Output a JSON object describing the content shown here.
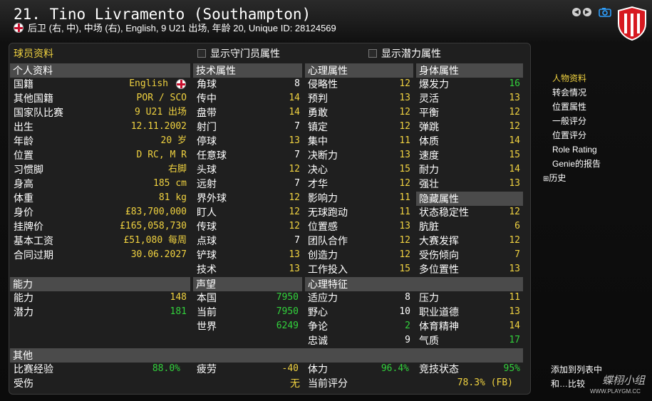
{
  "header": {
    "title": "21. Tino Livramento (Southampton)",
    "subtitle": "后卫 (右, 中), 中场 (右), English, 9 U21 出场, 年龄 20, Unique ID: 28124569",
    "section_title": "球员资料",
    "show_gk_attrs": "显示守门员属性",
    "show_potential_attrs": "显示潜力属性"
  },
  "personal": {
    "heading": "个人资料",
    "rows": [
      {
        "label": "国籍",
        "value": "English"
      },
      {
        "label": "其他国籍",
        "value": "POR / SCO"
      },
      {
        "label": "国家队比赛",
        "value": "9 U21 出场"
      },
      {
        "label": "出生",
        "value": "12.11.2002"
      },
      {
        "label": "年龄",
        "value": "20 岁"
      },
      {
        "label": "位置",
        "value": "D RC, M R"
      },
      {
        "label": "习惯脚",
        "value": "右脚"
      },
      {
        "label": "身高",
        "value": "185 cm"
      },
      {
        "label": "体重",
        "value": "81 kg"
      },
      {
        "label": "身价",
        "value": "£83,700,000"
      },
      {
        "label": "挂牌价",
        "value": "£165,058,730"
      },
      {
        "label": "基本工资",
        "value": "£51,080 每周"
      },
      {
        "label": "合同过期",
        "value": "30.06.2027"
      }
    ]
  },
  "technical": {
    "heading": "技术属性",
    "rows": [
      {
        "label": "角球",
        "value": "8",
        "color": "#ffffff"
      },
      {
        "label": "传中",
        "value": "14",
        "color": "#f0d240"
      },
      {
        "label": "盘带",
        "value": "14",
        "color": "#f0d240"
      },
      {
        "label": "射门",
        "value": "7",
        "color": "#ffffff"
      },
      {
        "label": "停球",
        "value": "13",
        "color": "#f0d240"
      },
      {
        "label": "任意球",
        "value": "7",
        "color": "#ffffff"
      },
      {
        "label": "头球",
        "value": "12",
        "color": "#f0d240"
      },
      {
        "label": "远射",
        "value": "7",
        "color": "#ffffff"
      },
      {
        "label": "界外球",
        "value": "12",
        "color": "#f0d240"
      },
      {
        "label": "盯人",
        "value": "12",
        "color": "#f0d240"
      },
      {
        "label": "传球",
        "value": "12",
        "color": "#f0d240"
      },
      {
        "label": "点球",
        "value": "7",
        "color": "#ffffff"
      },
      {
        "label": "铲球",
        "value": "13",
        "color": "#f0d240"
      },
      {
        "label": "技术",
        "value": "13",
        "color": "#f0d240"
      }
    ]
  },
  "mental": {
    "heading": "心理属性",
    "rows": [
      {
        "label": "侵略性",
        "value": "12",
        "color": "#f0d240"
      },
      {
        "label": "预判",
        "value": "13",
        "color": "#f0d240"
      },
      {
        "label": "勇敢",
        "value": "12",
        "color": "#f0d240"
      },
      {
        "label": "镇定",
        "value": "12",
        "color": "#f0d240"
      },
      {
        "label": "集中",
        "value": "11",
        "color": "#f0d240"
      },
      {
        "label": "决断力",
        "value": "13",
        "color": "#f0d240"
      },
      {
        "label": "决心",
        "value": "15",
        "color": "#f0d240"
      },
      {
        "label": "才华",
        "value": "12",
        "color": "#f0d240"
      },
      {
        "label": "影响力",
        "value": "11",
        "color": "#f0d240"
      },
      {
        "label": "无球跑动",
        "value": "11",
        "color": "#f0d240"
      },
      {
        "label": "位置感",
        "value": "13",
        "color": "#f0d240"
      },
      {
        "label": "团队合作",
        "value": "12",
        "color": "#f0d240"
      },
      {
        "label": "创造力",
        "value": "12",
        "color": "#f0d240"
      },
      {
        "label": "工作投入",
        "value": "15",
        "color": "#f0d240"
      }
    ]
  },
  "physical": {
    "heading": "身体属性",
    "rows": [
      {
        "label": "爆发力",
        "value": "16",
        "color": "#32d23c"
      },
      {
        "label": "灵活",
        "value": "13",
        "color": "#f0d240"
      },
      {
        "label": "平衡",
        "value": "12",
        "color": "#f0d240"
      },
      {
        "label": "弹跳",
        "value": "12",
        "color": "#f0d240"
      },
      {
        "label": "体质",
        "value": "14",
        "color": "#f0d240"
      },
      {
        "label": "速度",
        "value": "15",
        "color": "#f0d240"
      },
      {
        "label": "耐力",
        "value": "14",
        "color": "#f0d240"
      },
      {
        "label": "强壮",
        "value": "13",
        "color": "#f0d240"
      }
    ]
  },
  "hidden": {
    "heading": "隐藏属性",
    "rows": [
      {
        "label": "状态稳定性",
        "value": "12",
        "color": "#f0d240"
      },
      {
        "label": "肮脏",
        "value": "6",
        "color": "#f0d240"
      },
      {
        "label": "大赛发挥",
        "value": "12",
        "color": "#f0d240"
      },
      {
        "label": "受伤倾向",
        "value": "7",
        "color": "#f0d240"
      },
      {
        "label": "多位置性",
        "value": "13",
        "color": "#f0d240"
      }
    ]
  },
  "ability": {
    "heading": "能力",
    "rows": [
      {
        "label": "能力",
        "value": "148",
        "color": "#f0d240"
      },
      {
        "label": "潜力",
        "value": "181",
        "color": "#32d23c"
      }
    ]
  },
  "reputation": {
    "heading": "声望",
    "rows": [
      {
        "label": "本国",
        "value": "7950",
        "color": "#32d23c"
      },
      {
        "label": "当前",
        "value": "7950",
        "color": "#32d23c"
      },
      {
        "label": "世界",
        "value": "6249",
        "color": "#32d23c"
      }
    ]
  },
  "traits": {
    "heading": "心理特征",
    "left": [
      {
        "label": "适应力",
        "value": "8",
        "color": "#ffffff"
      },
      {
        "label": "野心",
        "value": "10",
        "color": "#ffffff"
      },
      {
        "label": "争论",
        "value": "2",
        "color": "#32d23c"
      },
      {
        "label": "忠诚",
        "value": "9",
        "color": "#ffffff"
      }
    ],
    "right": [
      {
        "label": "压力",
        "value": "11",
        "color": "#f0d240"
      },
      {
        "label": "职业道德",
        "value": "13",
        "color": "#f0d240"
      },
      {
        "label": "体育精神",
        "value": "14",
        "color": "#f0d240"
      },
      {
        "label": "气质",
        "value": "17",
        "color": "#32d23c"
      }
    ]
  },
  "other": {
    "heading": "其他",
    "row1": [
      {
        "label": "比赛经验",
        "value": "88.0%",
        "color": "#32d23c"
      },
      {
        "label": "疲劳",
        "value": "-40",
        "color": "#f0d240"
      },
      {
        "label": "体力",
        "value": "96.4%",
        "color": "#32d23c"
      },
      {
        "label": "竞技状态",
        "value": "95%",
        "color": "#32d23c"
      }
    ],
    "row2": [
      {
        "label": "受伤",
        "value": "无",
        "color": "#f0d240"
      },
      {
        "label": "当前评分",
        "value": "78.3% (FB)",
        "color": "#f0d240"
      }
    ]
  },
  "sidebar": {
    "items": [
      "人物资料",
      "转会情况",
      "位置属性",
      "一般评分",
      "位置评分",
      "Role Rating",
      "Genie的报告"
    ],
    "history": "历史",
    "add_to_list": "添加到列表中",
    "compare": "和…比较",
    "watermark": "蝶栩小组",
    "watermark_url": "WWW.PLAYGM.CC"
  },
  "colors": {
    "yellow": "#f0d240",
    "green": "#32d23c",
    "active": "#f0d240"
  }
}
